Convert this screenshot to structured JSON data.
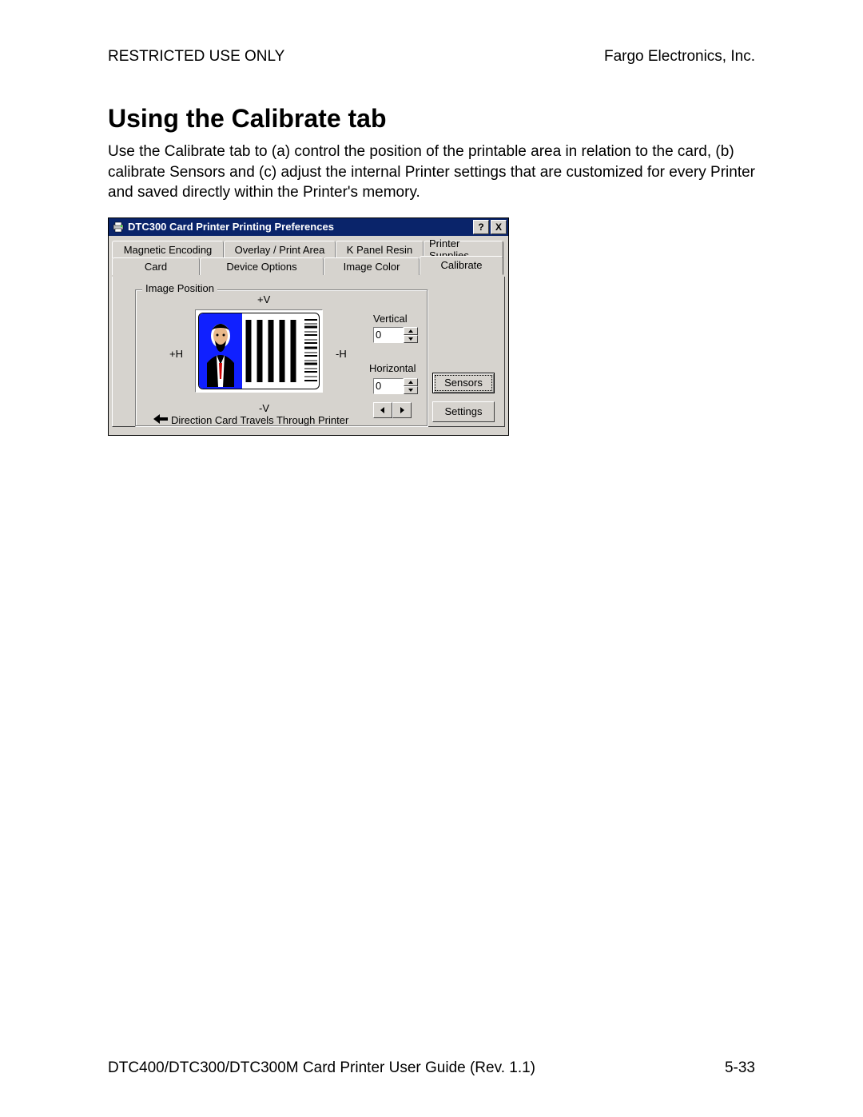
{
  "header": {
    "left": "RESTRICTED USE ONLY",
    "right": "Fargo Electronics, Inc."
  },
  "title": "Using the Calibrate tab",
  "body": "Use the Calibrate tab to (a) control the position of the printable area in relation to the card, (b) calibrate Sensors and (c) adjust the internal Printer settings that are customized for every Printer and saved directly within the Printer's memory.",
  "footer": {
    "left": "DTC400/DTC300/DTC300M Card Printer User Guide (Rev. 1.1)",
    "right": "5-33"
  },
  "dialog": {
    "title": "DTC300 Card Printer Printing Preferences",
    "title_buttons": {
      "help": "?",
      "close": "X"
    },
    "tabs_back": [
      "Magnetic Encoding",
      "Overlay / Print Area",
      "K Panel Resin",
      "Printer Supplies"
    ],
    "tabs_front": [
      "Card",
      "Device Options",
      "Image Color",
      "Calibrate"
    ],
    "active_tab": "Calibrate",
    "fieldset_label": "Image Position",
    "labels": {
      "plus_v": "+V",
      "minus_v": "-V",
      "plus_h": "+H",
      "minus_h": "-H"
    },
    "direction_text": "Direction Card Travels Through Printer",
    "vertical": {
      "label": "Vertical",
      "value": "0"
    },
    "horizontal": {
      "label": "Horizontal",
      "value": "0"
    },
    "buttons": {
      "sensors": "Sensors",
      "settings": "Settings"
    }
  }
}
